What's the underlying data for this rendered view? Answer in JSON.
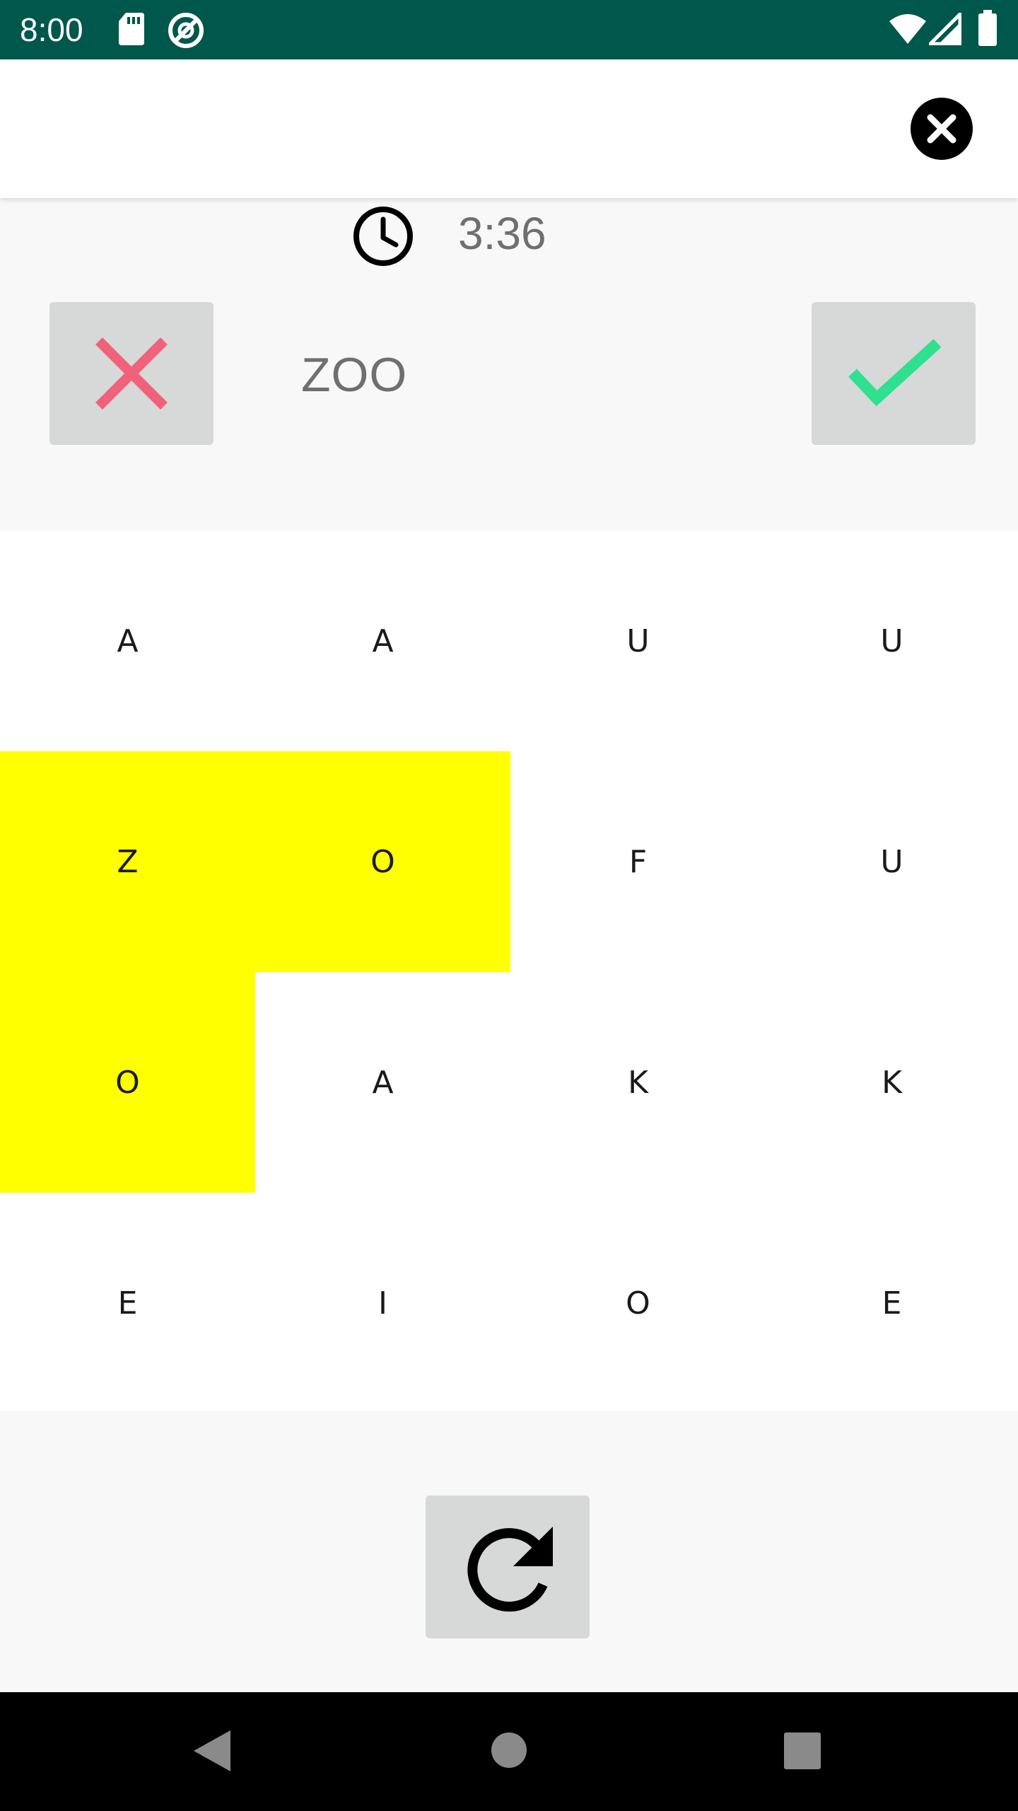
{
  "status_bar": {
    "time": "8:00",
    "icons": [
      "sd-card-icon",
      "vpn-icon",
      "wifi-icon",
      "signal-icon",
      "battery-icon"
    ]
  },
  "app_bar": {
    "close_icon": "close-circle-icon"
  },
  "game": {
    "timer": "3:36",
    "current_word": "ZOO",
    "reject_color": "#f0627a",
    "accept_color": "#2fe08f",
    "highlight_color": "#ffff00"
  },
  "grid": {
    "rows": [
      [
        "A",
        "A",
        "U",
        "U"
      ],
      [
        "Z",
        "O",
        "F",
        "U"
      ],
      [
        "O",
        "A",
        "K",
        "K"
      ],
      [
        "E",
        "I",
        "O",
        "E"
      ]
    ],
    "selected_cells": [
      [
        1,
        0
      ],
      [
        1,
        1
      ],
      [
        2,
        0
      ]
    ]
  },
  "nav_bar": {
    "buttons": [
      "back-icon",
      "home-icon",
      "recents-icon"
    ]
  }
}
